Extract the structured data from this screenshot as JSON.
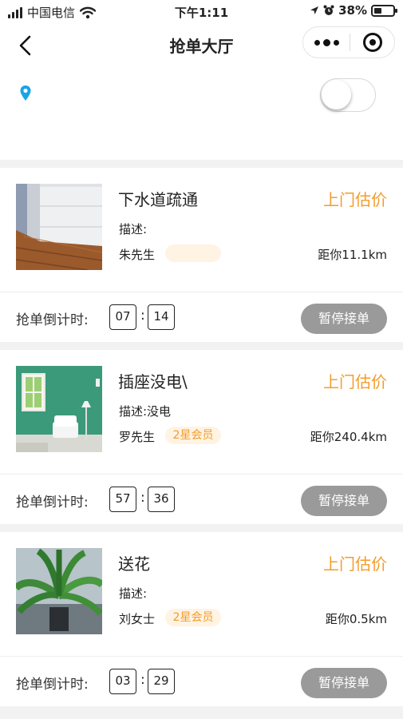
{
  "status_bar": {
    "carrier": "中国电信",
    "time": "下午1:11",
    "battery": "38%"
  },
  "nav": {
    "title": "抢单大厅"
  },
  "location": {
    "text": "",
    "toggle_on": false
  },
  "orders": [
    {
      "title": "下水道疏通",
      "price_label": "上门估价",
      "description": "描述:",
      "customer": "朱先生",
      "member_badge": "",
      "distance": "距你11.1km",
      "countdown_label": "抢单倒计时:",
      "countdown_minutes": "07",
      "countdown_seconds": "14",
      "action_label": "暂停接单",
      "image": "room-floor-photo"
    },
    {
      "title": "插座没电\\",
      "price_label": "上门估价",
      "description": "描述:没电",
      "customer": "罗先生",
      "member_badge": "2星会员",
      "distance": "距你240.4km",
      "countdown_label": "抢单倒计时:",
      "countdown_minutes": "57",
      "countdown_seconds": "36",
      "action_label": "暂停接单",
      "image": "green-living-room-photo"
    },
    {
      "title": "送花",
      "price_label": "上门估价",
      "description": "描述:",
      "customer": "刘女士",
      "member_badge": "2星会员",
      "distance": "距你0.5km",
      "countdown_label": "抢单倒计时:",
      "countdown_minutes": "03",
      "countdown_seconds": "29",
      "action_label": "暂停接单",
      "image": "potted-plant-photo"
    }
  ],
  "colors": {
    "accent": "#f39c2b",
    "badge_bg": "#fff3e3",
    "location_pin": "#1aa3e8",
    "pause_button": "#9a9a9a"
  }
}
